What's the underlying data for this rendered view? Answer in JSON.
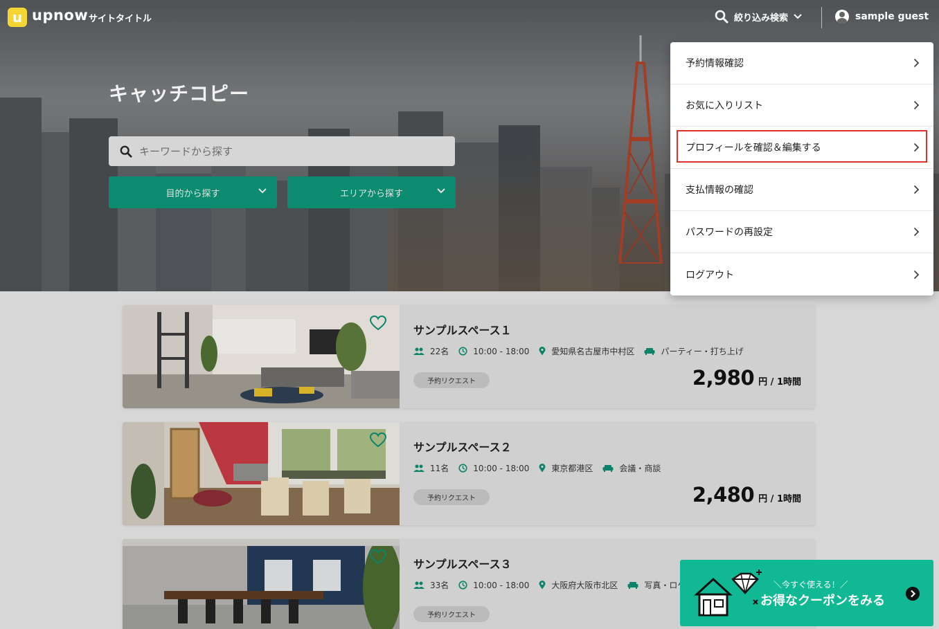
{
  "header": {
    "logo_letter": "u",
    "logo_text": "upnow",
    "site_title": "サイトタイトル",
    "filter_label": "絞り込み検索",
    "user_name": "sample guest"
  },
  "hero": {
    "catch_copy": "キャッチコピー",
    "search_placeholder": "キーワードから探す",
    "purpose_dropdown": "目的から探す",
    "area_dropdown": "エリアから探す"
  },
  "menu": {
    "items": [
      {
        "label": "予約情報確認"
      },
      {
        "label": "お気に入りリスト"
      },
      {
        "label": "プロフィールを確認＆編集する",
        "highlighted": true
      },
      {
        "label": "支払情報の確認"
      },
      {
        "label": "パスワードの再設定"
      },
      {
        "label": "ログアウト"
      }
    ]
  },
  "spaces": [
    {
      "name": "サンプルスペース１",
      "capacity": "22名",
      "hours": "10:00 - 18:00",
      "location": "愛知県名古屋市中村区",
      "purpose": "パーティー・打ち上げ",
      "badge": "予約リクエスト",
      "price": "2,980",
      "price_unit": "円 / 1時間"
    },
    {
      "name": "サンプルスペース２",
      "capacity": "11名",
      "hours": "10:00 - 18:00",
      "location": "東京都港区",
      "purpose": "会議・商談",
      "badge": "予約リクエスト",
      "price": "2,480",
      "price_unit": "円 / 1時間"
    },
    {
      "name": "サンプルスペース３",
      "capacity": "33名",
      "hours": "10:00 - 18:00",
      "location": "大阪府大阪市北区",
      "purpose": "写真・ロケ",
      "badge": "予約リクエスト"
    }
  ],
  "coupon": {
    "sub": "＼今すぐ使える！／",
    "main": "お得なクーポンをみる"
  },
  "colors": {
    "accent": "#0b8b6f",
    "coupon_bg": "#10b894",
    "highlight_border": "#e0302a",
    "logo_yellow": "#f5d533"
  },
  "icons": {
    "search": "search-icon",
    "chevron": "chevron-down-icon",
    "user": "user-icon",
    "people": "people-icon",
    "clock": "clock-icon",
    "pin": "location-pin-icon",
    "sofa": "sofa-icon",
    "heart": "heart-icon"
  }
}
